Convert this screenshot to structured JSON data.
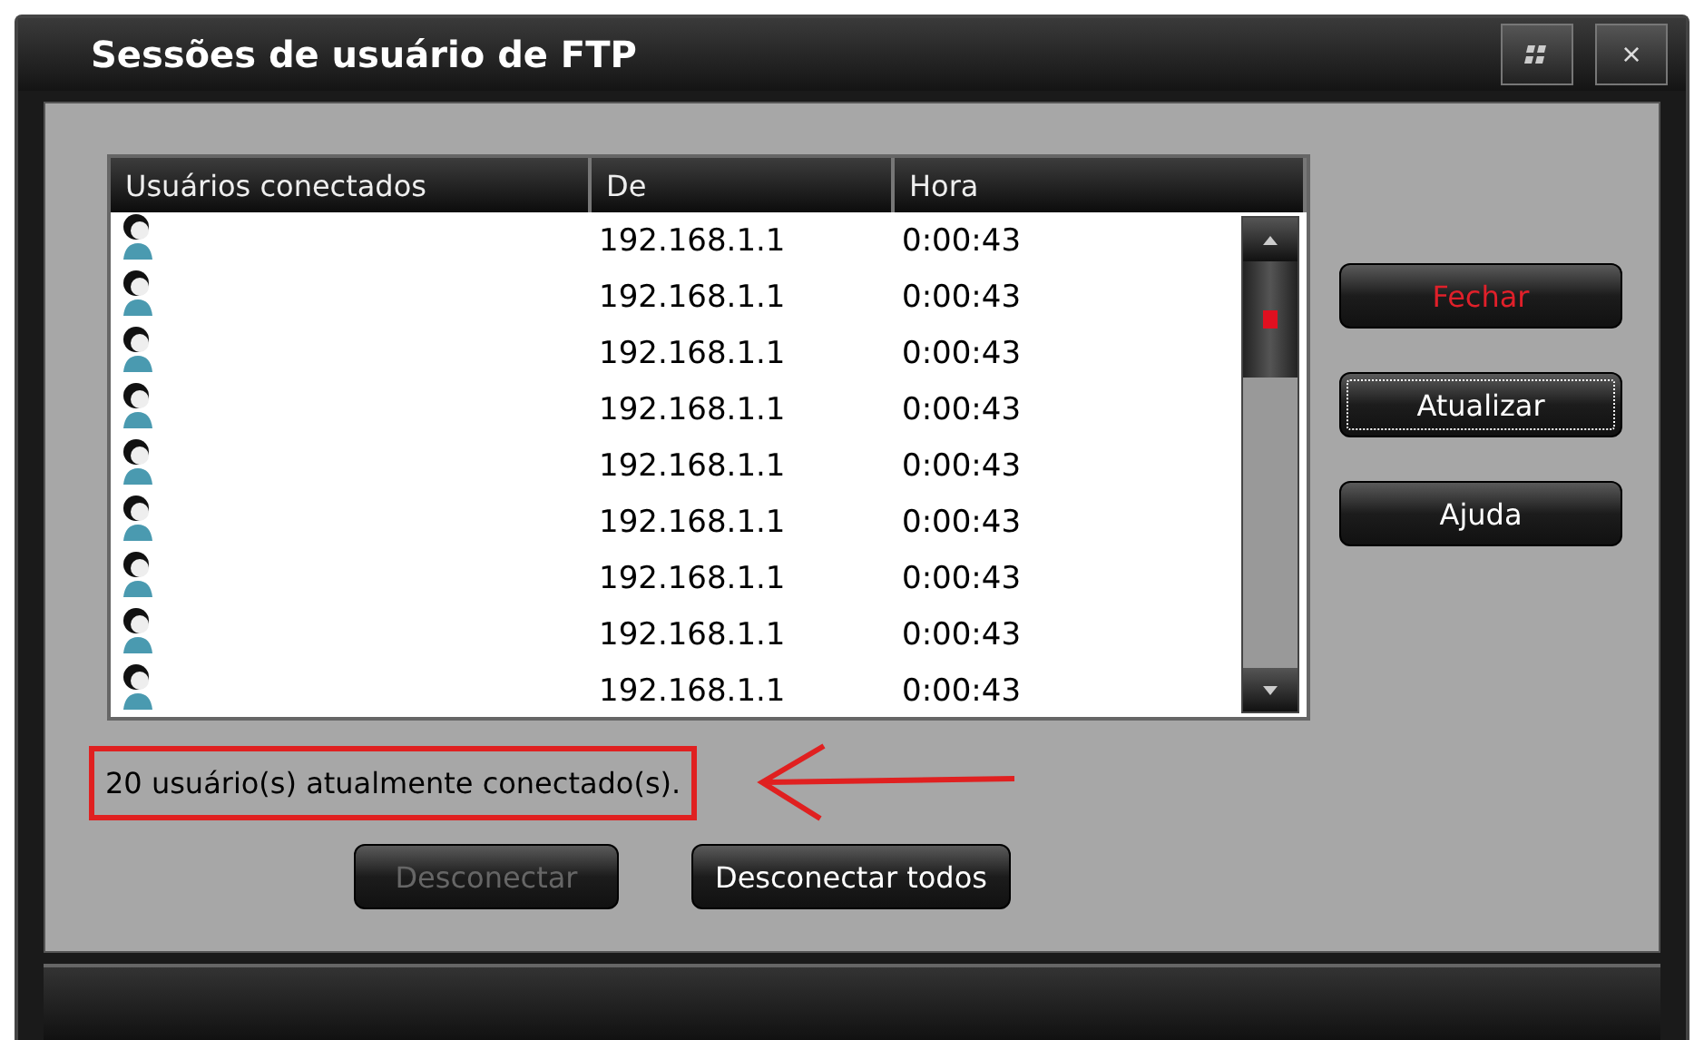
{
  "window": {
    "title": "Sessões de usuário de FTP",
    "close_glyph": "×"
  },
  "table": {
    "columns": [
      "Usuários conectados",
      "De",
      "Hora"
    ],
    "rows": [
      {
        "from": "192.168.1.1",
        "time": "0:00:43"
      },
      {
        "from": "192.168.1.1",
        "time": "0:00:43"
      },
      {
        "from": "192.168.1.1",
        "time": "0:00:43"
      },
      {
        "from": "192.168.1.1",
        "time": "0:00:43"
      },
      {
        "from": "192.168.1.1",
        "time": "0:00:43"
      },
      {
        "from": "192.168.1.1",
        "time": "0:00:43"
      },
      {
        "from": "192.168.1.1",
        "time": "0:00:43"
      },
      {
        "from": "192.168.1.1",
        "time": "0:00:43"
      },
      {
        "from": "192.168.1.1",
        "time": "0:00:43"
      }
    ]
  },
  "side_buttons": [
    {
      "label": "Fechar",
      "accent": true,
      "focused": false
    },
    {
      "label": "Atualizar",
      "accent": false,
      "focused": true
    },
    {
      "label": "Ajuda",
      "accent": false,
      "focused": false
    }
  ],
  "status": {
    "text": "20 usuário(s) atualmente conectado(s).",
    "highlighted": true
  },
  "bottom_buttons": [
    {
      "label": "Desconectar",
      "disabled": true
    },
    {
      "label": "Desconectar todos",
      "disabled": false
    }
  ]
}
